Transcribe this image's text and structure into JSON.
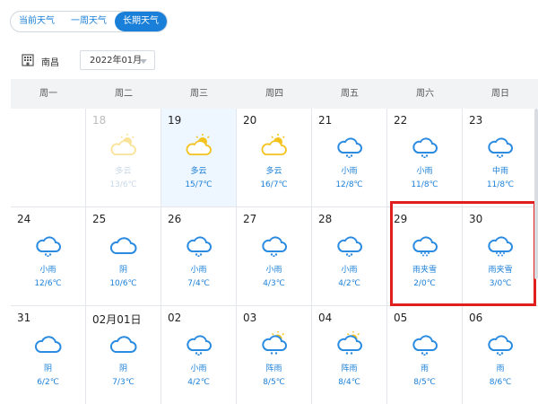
{
  "tabs": [
    "当前天气",
    "一周天气",
    "长期天气"
  ],
  "active_tab": 2,
  "city": "南昌",
  "month": "2022年01月",
  "weekdays": [
    "周一",
    "周二",
    "周三",
    "周四",
    "周五",
    "周六",
    "周日"
  ],
  "accent": "#1a7fd8",
  "highlight_color": "#e0201f",
  "rows": [
    [
      {
        "date": "",
        "cond": "",
        "temp": "",
        "icon": "empty"
      },
      {
        "date": "18",
        "cond": "多云",
        "temp": "13/6℃",
        "icon": "partly-cloudy",
        "past": true
      },
      {
        "date": "19",
        "cond": "多云",
        "temp": "15/7℃",
        "icon": "partly-cloudy",
        "today": true
      },
      {
        "date": "20",
        "cond": "多云",
        "temp": "16/7℃",
        "icon": "partly-cloudy"
      },
      {
        "date": "21",
        "cond": "小雨",
        "temp": "12/8℃",
        "icon": "rain"
      },
      {
        "date": "22",
        "cond": "小雨",
        "temp": "11/8℃",
        "icon": "rain"
      },
      {
        "date": "23",
        "cond": "中雨",
        "temp": "11/8℃",
        "icon": "rain"
      }
    ],
    [
      {
        "date": "24",
        "cond": "小雨",
        "temp": "12/6℃",
        "icon": "rain"
      },
      {
        "date": "25",
        "cond": "阴",
        "temp": "10/6℃",
        "icon": "cloudy"
      },
      {
        "date": "26",
        "cond": "小雨",
        "temp": "7/4℃",
        "icon": "rain"
      },
      {
        "date": "27",
        "cond": "小雨",
        "temp": "4/3℃",
        "icon": "rain"
      },
      {
        "date": "28",
        "cond": "小雨",
        "temp": "4/2℃",
        "icon": "rain"
      },
      {
        "date": "29",
        "cond": "雨夹雪",
        "temp": "2/0℃",
        "icon": "sleet"
      },
      {
        "date": "30",
        "cond": "雨夹雪",
        "temp": "3/0℃",
        "icon": "sleet"
      }
    ],
    [
      {
        "date": "31",
        "cond": "阴",
        "temp": "6/2℃",
        "icon": "cloudy"
      },
      {
        "date": "02月01日",
        "cond": "阴",
        "temp": "7/3℃",
        "icon": "cloudy"
      },
      {
        "date": "02",
        "cond": "小雨",
        "temp": "4/2℃",
        "icon": "rain"
      },
      {
        "date": "03",
        "cond": "阵雨",
        "temp": "8/5℃",
        "icon": "sun-rain"
      },
      {
        "date": "04",
        "cond": "阵雨",
        "temp": "8/4℃",
        "icon": "sun-rain"
      },
      {
        "date": "05",
        "cond": "雨",
        "temp": "8/5℃",
        "icon": "rain"
      },
      {
        "date": "06",
        "cond": "雨",
        "temp": "8/6℃",
        "icon": "rain"
      }
    ]
  ]
}
